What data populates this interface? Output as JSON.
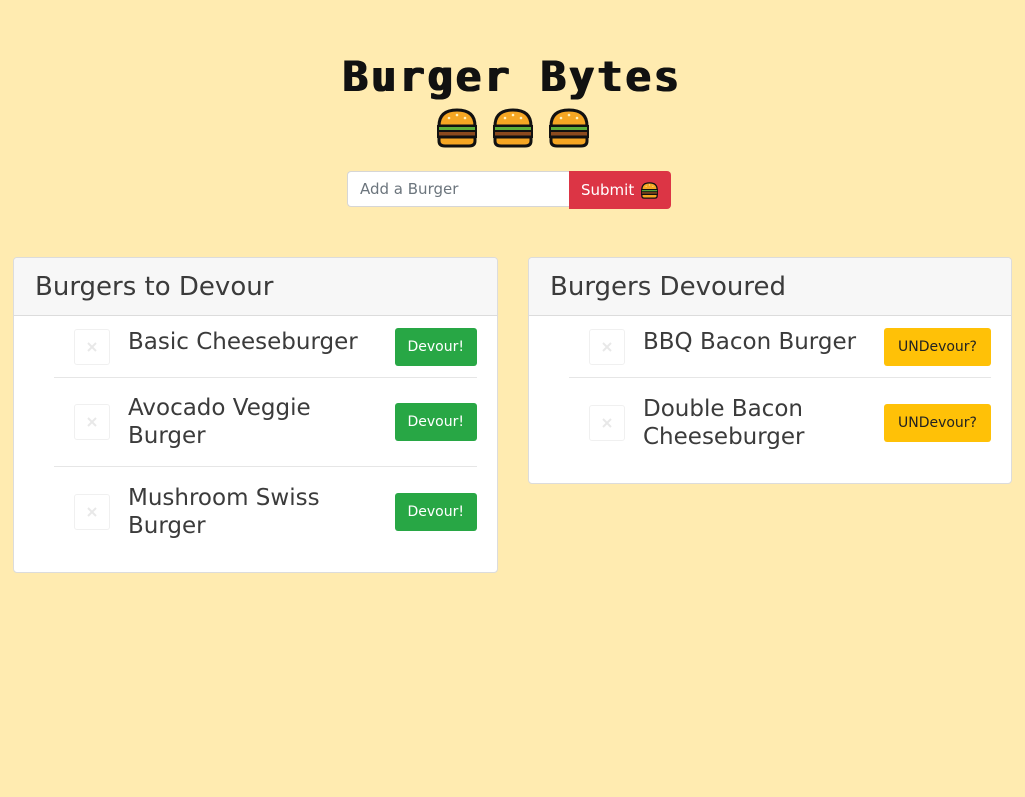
{
  "header": {
    "title": "Burger Bytes",
    "icons": [
      "burger-icon",
      "burger-icon",
      "burger-icon"
    ]
  },
  "form": {
    "placeholder": "Add a Burger",
    "value": "",
    "submit_label": "Submit",
    "submit_icon": "burger-icon"
  },
  "colors": {
    "background": "#ffebb0",
    "submit": "#dc3545",
    "devour": "#28a745",
    "undevour": "#ffc107"
  },
  "to_devour": {
    "heading": "Burgers to Devour",
    "items": [
      {
        "name": "Basic Cheeseburger",
        "action": "Devour!"
      },
      {
        "name": "Avocado Veggie Burger",
        "action": "Devour!"
      },
      {
        "name": "Mushroom Swiss Burger",
        "action": "Devour!"
      }
    ]
  },
  "devoured": {
    "heading": "Burgers Devoured",
    "items": [
      {
        "name": "BBQ Bacon Burger",
        "action": "UNDevour?"
      },
      {
        "name": "Double Bacon Cheeseburger",
        "action": "UNDevour?"
      }
    ]
  }
}
